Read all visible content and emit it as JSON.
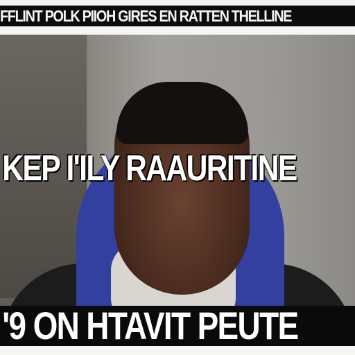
{
  "captions": {
    "top": "FFLINT POLK PIIOH GIRES EN RATTEN THELLINE",
    "middle": "KEP I'ILY RAAURITINE",
    "bottom": "'9 ON HTAVIT PEUTE"
  },
  "colors": {
    "caption_bg": "#0a0a0a",
    "caption_text": "#ffffff",
    "hood": "#3340a0"
  }
}
